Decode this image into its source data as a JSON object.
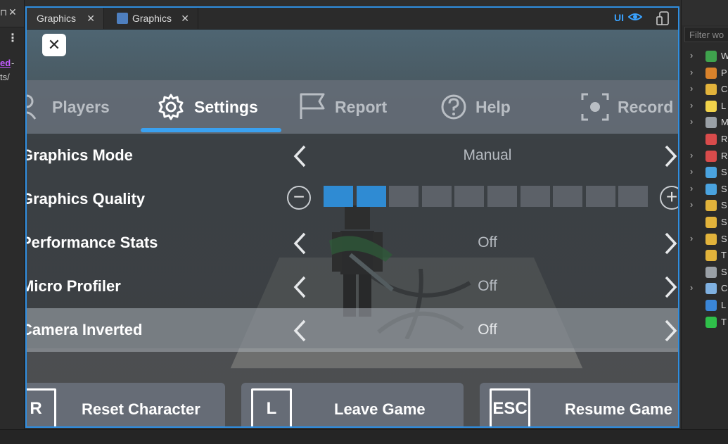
{
  "left_panel": {
    "pin_icon": "pin-icon",
    "link_text": "ed",
    "dash_text": "-",
    "path_text": "ts/"
  },
  "tabs": [
    {
      "label": "Graphics"
    },
    {
      "label": "Graphics"
    }
  ],
  "toolbar": {
    "ui_toggle": "UI"
  },
  "explorer": {
    "filter_placeholder": "Filter wo",
    "items": [
      {
        "letter": "W",
        "color": "#3fa34d"
      },
      {
        "letter": "P",
        "color": "#d9822b"
      },
      {
        "letter": "C",
        "color": "#e2b33b"
      },
      {
        "letter": "L",
        "color": "#f1d34a"
      },
      {
        "letter": "M",
        "color": "#9aa0a6"
      },
      {
        "letter": "R",
        "color": "#d94b4b"
      },
      {
        "letter": "R",
        "color": "#d94b4b"
      },
      {
        "letter": "S",
        "color": "#4aa3df"
      },
      {
        "letter": "S",
        "color": "#4aa3df"
      },
      {
        "letter": "S",
        "color": "#e2b33b"
      },
      {
        "letter": "S",
        "color": "#e2b33b"
      },
      {
        "letter": "S",
        "color": "#e2b33b"
      },
      {
        "letter": "T",
        "color": "#e2b33b"
      },
      {
        "letter": "S",
        "color": "#9aa0a6"
      },
      {
        "letter": "C",
        "color": "#7fb0e0"
      },
      {
        "letter": "L",
        "color": "#3a86d8"
      },
      {
        "letter": "T",
        "color": "#2fbf4a"
      }
    ]
  },
  "menu": {
    "close_label": "✕",
    "nav": [
      {
        "label": "Players",
        "icon": "players-icon",
        "active": false
      },
      {
        "label": "Settings",
        "icon": "gear-icon",
        "active": true
      },
      {
        "label": "Report",
        "icon": "flag-icon",
        "active": false
      },
      {
        "label": "Help",
        "icon": "question-icon",
        "active": false
      },
      {
        "label": "Record",
        "icon": "record-icon",
        "active": false
      }
    ],
    "settings": [
      {
        "label": "Graphics Mode",
        "value": "Manual"
      },
      {
        "label": "Graphics Quality",
        "value": "2"
      },
      {
        "label": "Performance Stats",
        "value": "Off"
      },
      {
        "label": "Micro Profiler",
        "value": "Off"
      },
      {
        "label": "Camera Inverted",
        "value": "Off"
      }
    ],
    "quality": {
      "level": 2,
      "max": 10
    },
    "actions": [
      {
        "key": "R",
        "label": "Reset Character"
      },
      {
        "key": "L",
        "label": "Leave Game"
      },
      {
        "key": "ESC",
        "label": "Resume Game"
      }
    ]
  },
  "colors": {
    "accent": "#3aa1f0",
    "quality_on": "#2f8bd3",
    "window_border": "#2f8ee0"
  }
}
